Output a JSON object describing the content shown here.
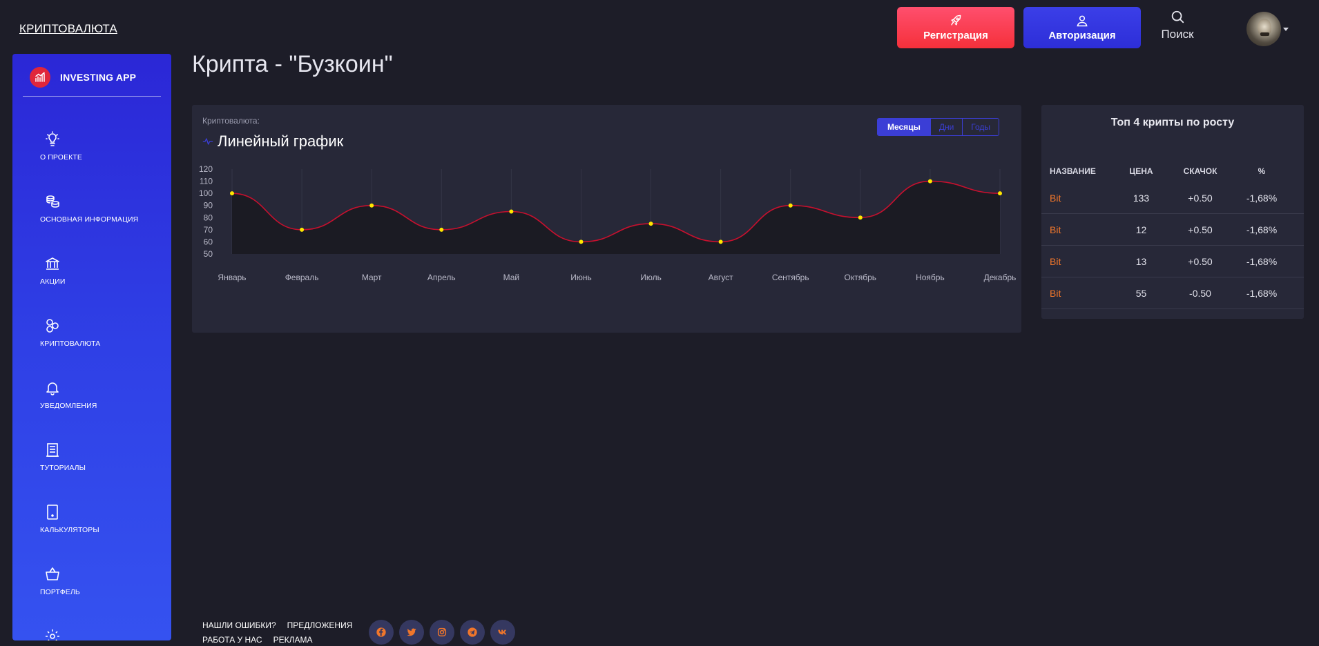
{
  "header": {
    "brand": "КРИПТОВАЛЮТА",
    "register_label": "Регистрация",
    "login_label": "Авторизация",
    "search_label": "Поиск"
  },
  "sidebar": {
    "app_name": "INVESTING APP",
    "items": [
      {
        "label": "О ПРОЕКТЕ",
        "icon": "lightbulb-icon"
      },
      {
        "label": "ОСНОВНАЯ ИНФОРМАЦИЯ",
        "icon": "coins-icon"
      },
      {
        "label": "АКЦИИ",
        "icon": "bank-icon"
      },
      {
        "label": "КРИПТОВАЛЮТА",
        "icon": "crypto-icon"
      },
      {
        "label": "УВЕДОМЛЕНИЯ",
        "icon": "bell-icon"
      },
      {
        "label": "ТУТОРИАЛЫ",
        "icon": "document-icon"
      },
      {
        "label": "КАЛЬКУЛЯТОРЫ",
        "icon": "tablet-icon"
      },
      {
        "label": "ПОРТФЕЛЬ",
        "icon": "basket-icon"
      }
    ]
  },
  "page": {
    "title": "Крипта - \"Бузкоин\""
  },
  "chart_card": {
    "subtitle": "Криптовалюта:",
    "title": "Линейный график",
    "periods": [
      "Месяцы",
      "Дни",
      "Годы"
    ],
    "active_period": "Месяцы"
  },
  "chart_data": {
    "type": "line",
    "categories": [
      "Январь",
      "Февраль",
      "Март",
      "Апрель",
      "Май",
      "Июнь",
      "Июль",
      "Август",
      "Сентябрь",
      "Октябрь",
      "Ноябрь",
      "Декабрь"
    ],
    "series": [
      {
        "values": [
          100,
          70,
          90,
          70,
          85,
          60,
          75,
          60,
          90,
          80,
          110,
          100
        ]
      }
    ],
    "yticks": [
      120,
      110,
      100,
      90,
      80,
      70,
      60,
      50
    ],
    "ylim": [
      50,
      120
    ],
    "line_color": "#c8102e",
    "point_color": "#ffe600",
    "grid": "vertical"
  },
  "top4": {
    "title": "Топ 4 крипты по росту",
    "columns": [
      "НАЗВАНИЕ",
      "ЦЕНА",
      "СКАЧОК",
      "%"
    ],
    "rows": [
      [
        "Bit",
        "133",
        "+0.50",
        "-1,68%"
      ],
      [
        "Bit",
        "12",
        "+0.50",
        "-1,68%"
      ],
      [
        "Bit",
        "13",
        "+0.50",
        "-1,68%"
      ],
      [
        "Bit",
        "55",
        "-0.50",
        "-1,68%"
      ]
    ]
  },
  "footer": {
    "links": [
      "НАШЛИ ОШИБКИ?",
      "ПРЕДЛОЖЕНИЯ",
      "РАБОТА У НАС",
      "РЕКЛАМА"
    ],
    "socials": [
      "facebook-icon",
      "twitter-icon",
      "instagram-icon",
      "telegram-icon",
      "vk-icon"
    ]
  }
}
